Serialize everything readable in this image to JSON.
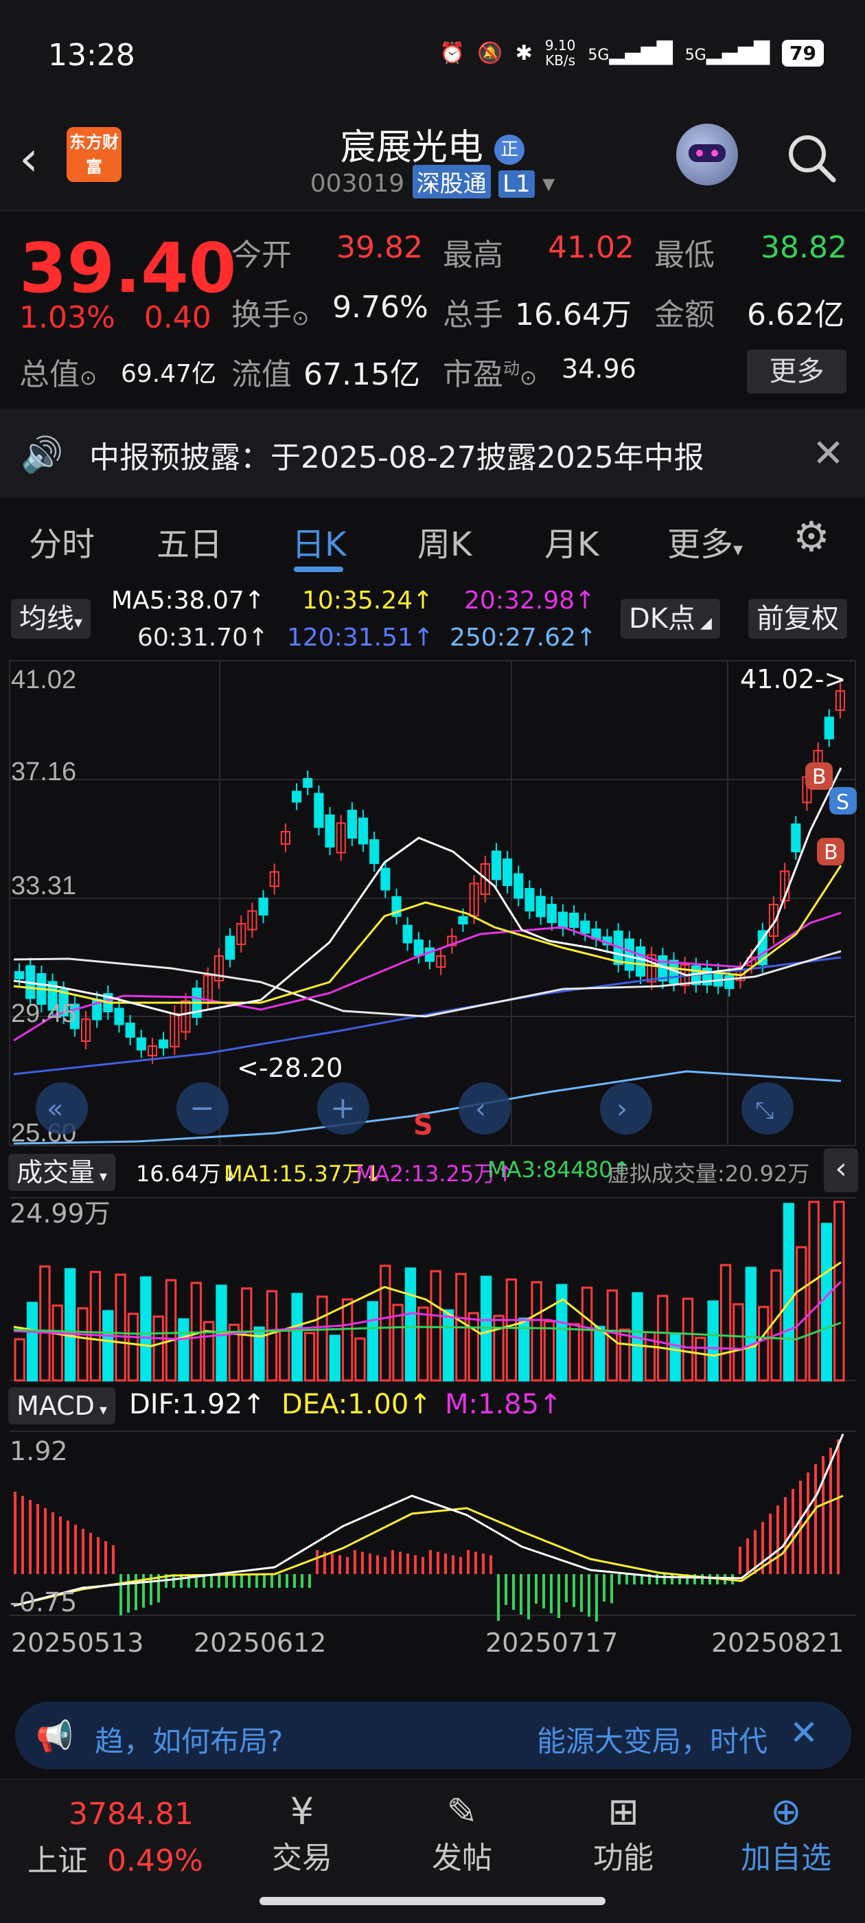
{
  "status": {
    "time": "13:28",
    "net_speed_value": "9.10",
    "net_speed_unit": "KB/s",
    "sim1": "5G",
    "sim2": "5G",
    "battery": "79"
  },
  "header": {
    "app_logo_text": "东方财富",
    "stock_name": "宸展光电",
    "name_badge": "正",
    "stock_code": "003019",
    "market_tag": "深股通",
    "level_tag": "L1"
  },
  "quote": {
    "price": "39.40",
    "change_pct": "1.03%",
    "change_amt": "0.40",
    "open_label": "今开",
    "open": "39.82",
    "high_label": "最高",
    "high": "41.02",
    "low_label": "最低",
    "low": "38.82",
    "turnover_label": "换手",
    "turnover": "9.76%",
    "volume_label": "总手",
    "volume": "16.64万",
    "amount_label": "金额",
    "amount": "6.62亿",
    "mktcap_label": "总值",
    "mktcap": "69.47亿",
    "float_label": "流值",
    "float_cap": "67.15亿",
    "pe_label": "市盈",
    "pe_sup": "动",
    "pe": "34.96",
    "more_label": "更多"
  },
  "notice": {
    "text": "中报预披露：于2025-08-27披露2025年中报"
  },
  "tabs": [
    "分时",
    "五日",
    "日K",
    "周K",
    "月K",
    "更多"
  ],
  "active_tab": "日K",
  "ma_panel": {
    "selector": "均线",
    "ma5": "MA5:38.07↑",
    "ma10": "10:35.24↑",
    "ma20": "20:32.98↑",
    "ma60": "60:31.70↑",
    "ma120": "120:31.51↑",
    "ma250": "250:27.62↑",
    "dk_label": "DK点",
    "adjust_label": "前复权"
  },
  "kline": {
    "y_top": "41.02",
    "y_2": "37.16",
    "y_3": "33.31",
    "y_4": "29.45",
    "y_bottom": "25.60",
    "max_marker": "41.02->",
    "min_marker": "<-28.20",
    "signal_b1": "B",
    "signal_b2": "B",
    "signal_s": "S",
    "signal_s_bottom": "S"
  },
  "volume_panel": {
    "selector": "成交量",
    "vol": "16.64万↓",
    "ma1": "MA1:15.37万↓",
    "ma2": "MA2:13.25万↑",
    "ma3": "MA3:84480↑",
    "virtual": "虚拟成交量:20.92万",
    "y_top": "24.99万"
  },
  "macd_panel": {
    "selector": "MACD",
    "dif": "DIF:1.92↑",
    "dea": "DEA:1.00↑",
    "m": "M:1.85↑",
    "y_top": "1.92",
    "y_bottom": "-0.75"
  },
  "x_dates": [
    "20250513",
    "20250612",
    "20250717",
    "20250821"
  ],
  "ad": {
    "text_left": "趋，如何布局?",
    "text_right": "能源大变局，时代"
  },
  "bottom": {
    "index_value": "3784.81",
    "index_name": "上证",
    "index_pct": "0.49%",
    "trade": "交易",
    "post": "发帖",
    "func": "功能",
    "watch": "加自选"
  },
  "colors": {
    "up": "#ff3b3b",
    "down": "#00e5e5",
    "accent": "#4a90e2",
    "brand": "#f26522",
    "ma5": "#ffffff",
    "ma10": "#ffee33",
    "ma20": "#e633e6",
    "ma60": "#e8e8e8",
    "ma120": "#3f5fe0",
    "ma250": "#6fb8ff"
  }
}
